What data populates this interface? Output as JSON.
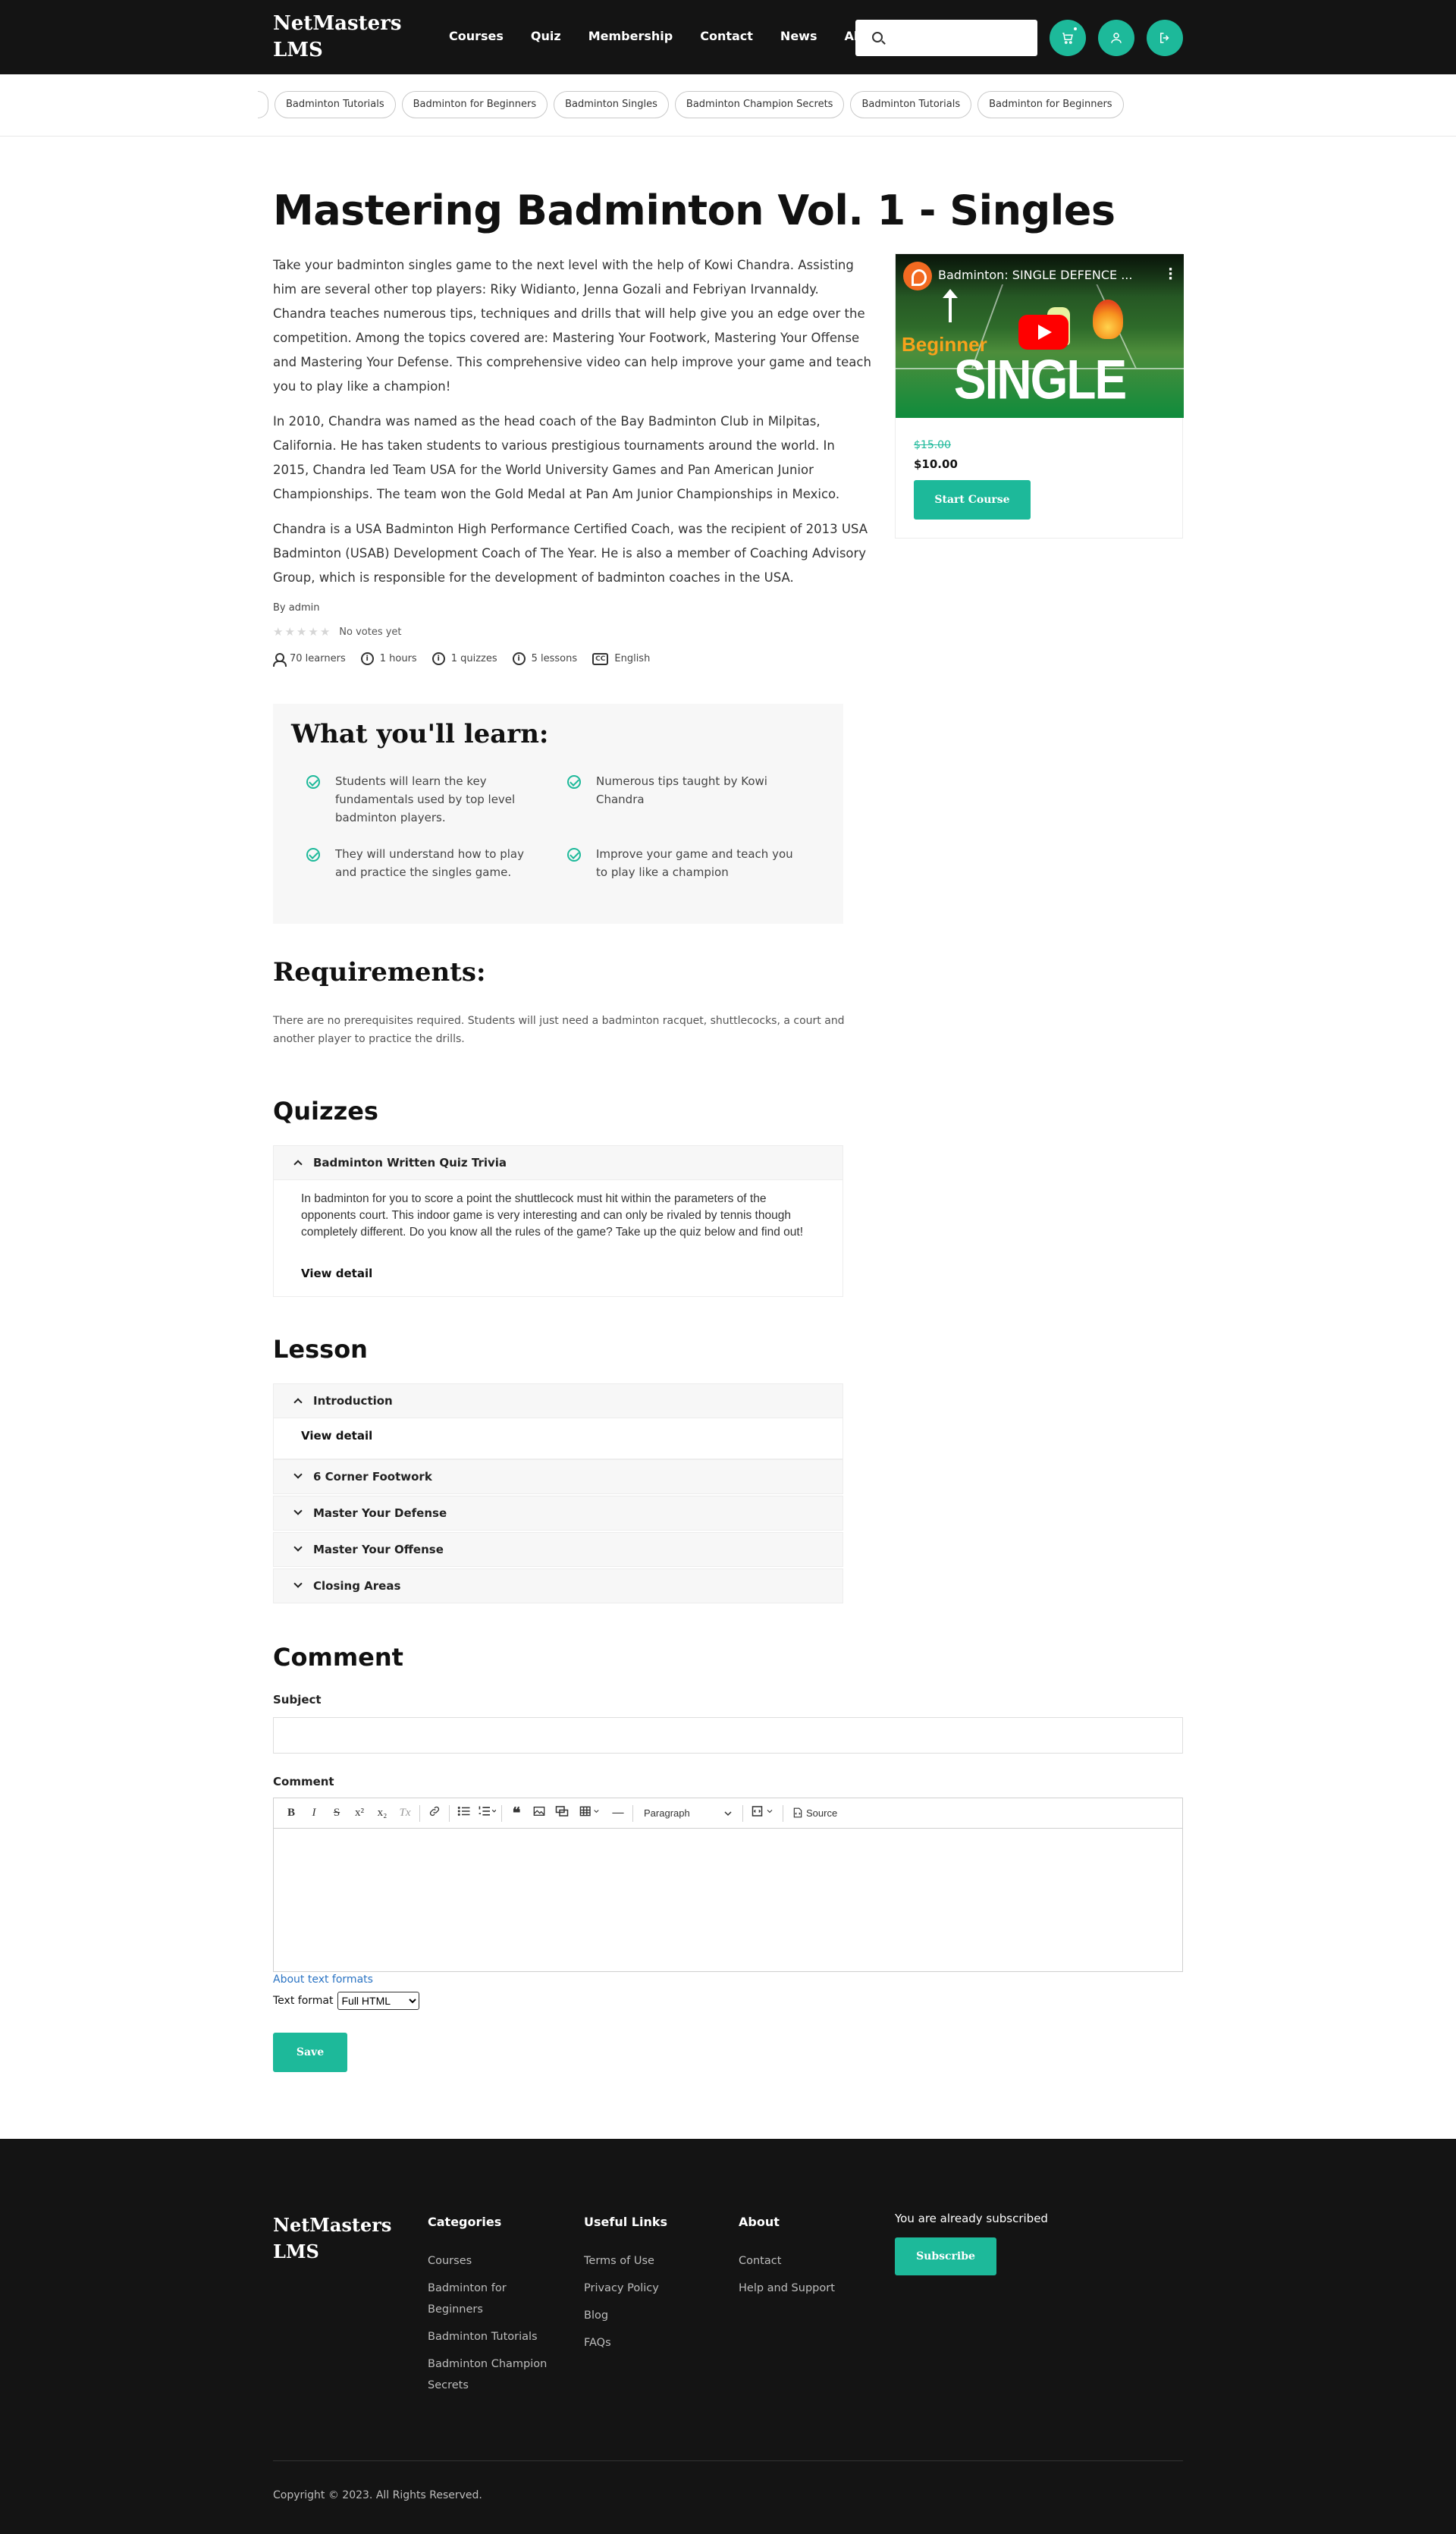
{
  "header": {
    "logo": "NetMasters LMS",
    "nav": [
      "Courses",
      "Quiz",
      "Membership",
      "Contact",
      "News"
    ],
    "nav_about": "About",
    "search_placeholder": "",
    "icons": [
      "cart-icon",
      "user-icon",
      "logout-icon"
    ]
  },
  "tags": [
    "Badminton Tutorials",
    "Badminton for Beginners",
    "Badminton Singles",
    "Badminton Champion Secrets",
    "Badminton Tutorials",
    "Badminton for Beginners"
  ],
  "course": {
    "title": "Mastering Badminton Vol. 1 - Singles",
    "paragraphs": [
      "Take your badminton singles game to the next level with the help of Kowi Chandra. Assisting him are several other top players: Riky Widianto, Jenna Gozali and Febriyan Irvannaldy. Chandra teaches numerous tips, techniques and drills that will help give you an edge over the competition. Among the topics covered are: Mastering Your Footwork, Mastering Your Offense and Mastering Your Defense. This comprehensive video can help improve your game and teach you to play like a champion!",
      "In 2010, Chandra was named as the head coach of the Bay Badminton Club in Milpitas, California. He has taken students to various prestigious tournaments around the world. In 2015, Chandra led Team USA for the World University Games and Pan American Junior Championships. The team won the Gold Medal at Pan Am Junior Championships in Mexico.",
      "Chandra is a USA Badminton High Performance Certified Coach, was the recipient of 2013 USA Badminton (USAB) Development Coach of The Year. He is also a member of Coaching Advisory Group, which is responsible for the development of badminton coaches in the USA."
    ],
    "by_label": "By",
    "author": "admin",
    "rating": 0,
    "votes_text": "No votes yet",
    "meta": {
      "learners": "70 learners",
      "hours": "1 hours",
      "quizzes": "1 quizzes",
      "lessons": "5 lessons",
      "language": "English",
      "info_glyph": "i",
      "cc_glyph": "CC"
    }
  },
  "card": {
    "video_title": "Badminton: SINGLE DEFENCE ...",
    "video_beginner": "Beginner",
    "video_big": "SINGLE DEFENCE",
    "old_price": "$15.00",
    "price": "$10.00",
    "start_label": "Start Course"
  },
  "learn": {
    "heading": "What you'll learn:",
    "items": [
      "Students will learn the key fundamentals used by top level badminton players.",
      "Numerous tips taught by Kowi Chandra",
      "They will understand how to play and practice the singles game.",
      "Improve your game and teach you to play like a champion"
    ]
  },
  "requirements": {
    "heading": "Requirements:",
    "text": "There are no prerequisites required. Students will just need a badminton racquet, shuttlecocks, a court and another player to practice the drills."
  },
  "quizzes": {
    "heading": "Quizzes",
    "items": [
      {
        "title": "Badminton Written Quiz Trivia",
        "text": "In badminton for you to score a point the shuttlecock must hit within the parameters of the opponents court. This indoor game is very interesting and can only be rivaled by tennis though completely different. Do you know all the rules of the game? Take up the quiz below and find out!",
        "link": "View detail"
      }
    ]
  },
  "lessons": {
    "heading": "Lesson",
    "items": [
      "Introduction",
      "6 Corner Footwork",
      "Master Your Defense",
      "Master Your Offense",
      "Closing Areas"
    ],
    "link": "View detail"
  },
  "comment": {
    "heading": "Comment",
    "subject_label": "Subject",
    "comment_label": "Comment",
    "toolbar": {
      "bold": "B",
      "italic": "I",
      "strike": "S",
      "superscript": "x²",
      "subscript": "x₂",
      "clear_format": "Tx",
      "paragraph": "Paragraph",
      "source": "Source"
    },
    "about_formats": "About text formats",
    "text_format_label": "Text format",
    "text_format_value": "Full HTML",
    "save_label": "Save"
  },
  "footer": {
    "logo": "NetMasters LMS",
    "categories": {
      "heading": "Categories",
      "links": [
        "Courses",
        "Badminton for Beginners",
        "Badminton Tutorials",
        "Badminton Champion Secrets"
      ]
    },
    "useful": {
      "heading": "Useful Links",
      "links": [
        "Terms of Use",
        "Privacy Policy",
        "Blog",
        "FAQs"
      ]
    },
    "about": {
      "heading": "About",
      "links": [
        "Contact",
        "Help and Support"
      ]
    },
    "subscribed_text": "You are already subscribed",
    "subscribe_label": "Subscribe",
    "copyright": "Copyright © 2023. All Rights Reserved."
  }
}
